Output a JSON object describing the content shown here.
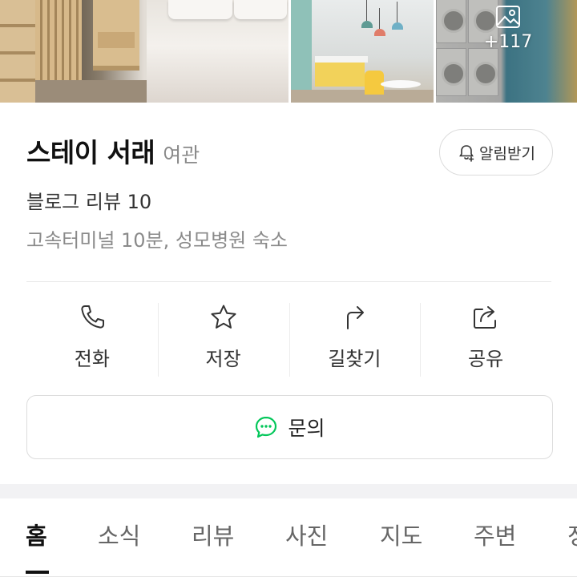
{
  "gallery": {
    "more_count": "+117",
    "photos": [
      "bedroom-photo",
      "kitchen-photo",
      "laundry-photo"
    ]
  },
  "place": {
    "name": "스테이 서래",
    "category": "여관",
    "review_text": "블로그 리뷰 10",
    "description": "고속터미널 10분, 성모병원 숙소"
  },
  "notify_button": {
    "label": "알림받기",
    "icon": "bell-plus-icon"
  },
  "actions": [
    {
      "label": "전화",
      "icon": "phone-icon"
    },
    {
      "label": "저장",
      "icon": "star-icon"
    },
    {
      "label": "길찾기",
      "icon": "directions-icon"
    },
    {
      "label": "공유",
      "icon": "share-icon"
    }
  ],
  "inquiry_button": {
    "label": "문의",
    "icon": "chat-icon",
    "icon_color": "#03c75a"
  },
  "tabs": [
    "홈",
    "소식",
    "리뷰",
    "사진",
    "지도",
    "주변",
    "정"
  ],
  "active_tab": "홈",
  "colors": {
    "accent_green": "#03c75a",
    "text_primary": "#111111",
    "text_secondary": "#8a8a8a"
  }
}
